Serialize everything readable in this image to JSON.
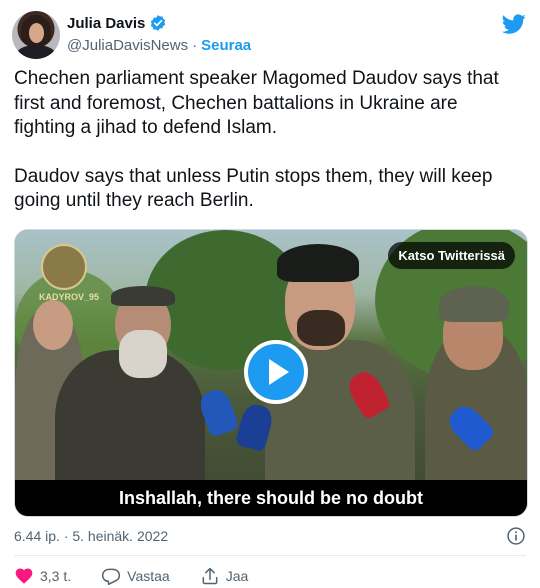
{
  "author": {
    "display_name": "Julia Davis",
    "handle": "@JuliaDavisNews",
    "separator": "·",
    "follow_label": "Seuraa"
  },
  "tweet": {
    "paragraph1": "Chechen parliament speaker Magomed Daudov says that\nfirst and foremost, Chechen battalions in Ukraine are\nfighting a jihad to defend Islam.",
    "paragraph2": "Daudov says that unless Putin stops them, they will keep\ngoing until they reach Berlin."
  },
  "media": {
    "watch_label": "Katso Twitterissä",
    "caption": "Inshallah, there should be no doubt",
    "watermark": "KADYROV_95"
  },
  "meta": {
    "timestamp": "6.44 ip. · 5. heinäk. 2022"
  },
  "actions": {
    "like_count": "3,3 t.",
    "reply_label": "Vastaa",
    "share_label": "Jaa"
  },
  "colors": {
    "accent": "#1d9bf0",
    "like": "#f91880",
    "muted": "#536471"
  },
  "icons": [
    "verified-icon",
    "twitter-logo-icon",
    "play-icon",
    "info-icon",
    "heart-icon",
    "reply-icon",
    "share-icon"
  ]
}
